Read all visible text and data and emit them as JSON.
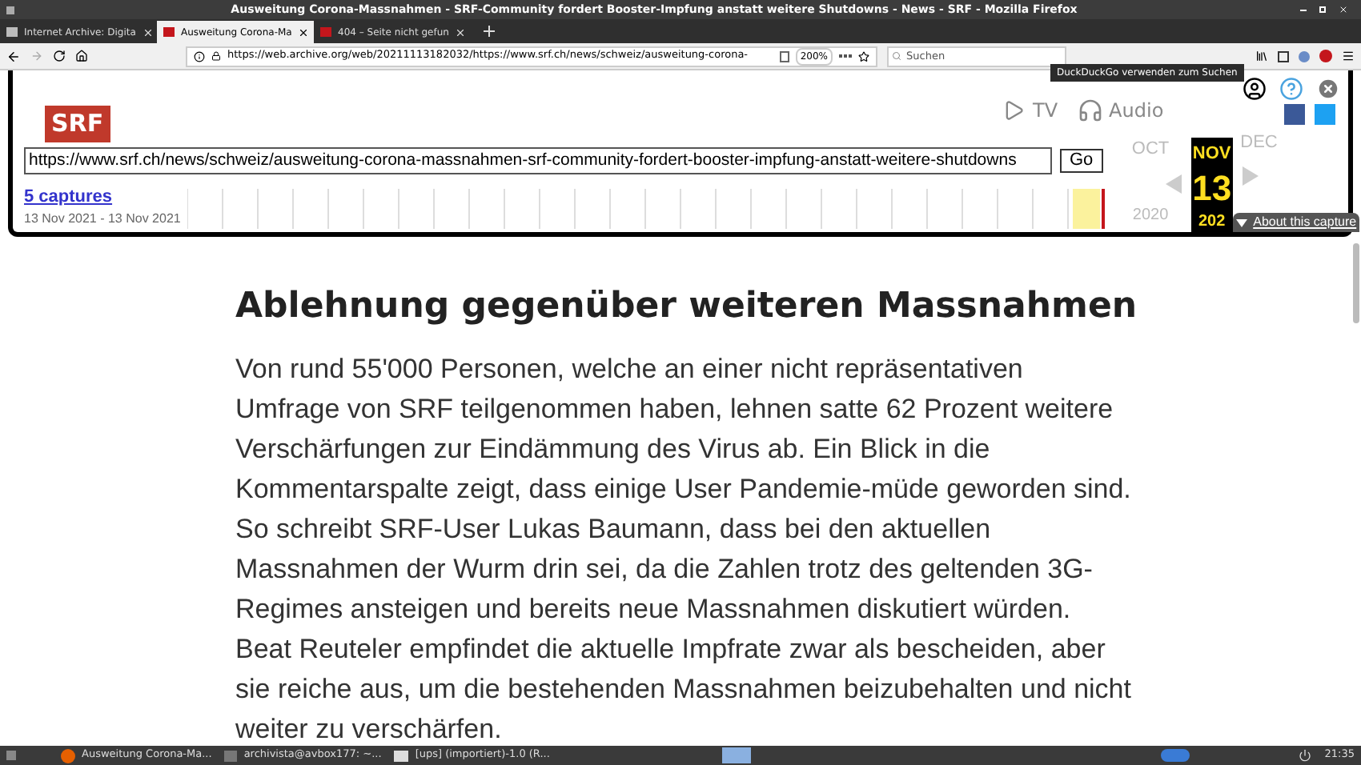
{
  "window": {
    "title": "Ausweitung Corona-Massnahmen - SRF-Community fordert Booster-Impfung anstatt weitere Shutdowns - News - SRF - Mozilla Firefox"
  },
  "tabs": [
    {
      "label": "Internet Archive: Digita",
      "selected": false
    },
    {
      "label": "Ausweitung Corona-Ma",
      "selected": true
    },
    {
      "label": "404 – Seite nicht gefun",
      "selected": false
    }
  ],
  "address_bar": {
    "url": "https://web.archive.org/web/20211113182032/https://www.srf.ch/news/schweiz/ausweitung-corona-",
    "zoom": "200%"
  },
  "search": {
    "placeholder": "Suchen"
  },
  "tooltip": "DuckDuckGo verwenden zum Suchen",
  "site_background": {
    "logo": "SRF",
    "nav": [
      "TV",
      "Audio"
    ]
  },
  "wayback": {
    "url": "https://www.srf.ch/news/schweiz/ausweitung-corona-massnahmen-srf-community-fordert-booster-impfung-anstatt-weitere-shutdowns",
    "go": "Go",
    "captures": "5 captures",
    "range": "13 Nov 2021 - 13 Nov 2021",
    "months": [
      {
        "label": "OCT",
        "selected": false
      },
      {
        "label": "NOV",
        "selected": true
      },
      {
        "label": "DEC",
        "selected": false
      }
    ],
    "day": "13",
    "years": [
      {
        "label": "2020",
        "selected": false
      },
      {
        "label": "202",
        "selected": true
      }
    ],
    "about": "About this capture"
  },
  "article": {
    "heading": "Ablehnung gegenüber weiteren Massnahmen",
    "paragraph": "Von rund 55'000 Personen, welche an einer nicht repräsentativen Umfrage von SRF teilgenommen haben, lehnen satte 62 Prozent weitere Verschärfungen zur Eindämmung des Virus ab. Ein Blick in die Kommentarspalte zeigt, dass einige User Pandemie-müde geworden sind. So schreibt SRF-User Lukas Baumann, dass bei den aktuellen Massnahmen der Wurm drin sei, da die Zahlen trotz des geltenden 3G-Regimes ansteigen und bereits neue Massnahmen diskutiert würden. Beat Reuteler empfindet die aktuelle Impfrate zwar als bescheiden, aber sie reiche aus, um die bestehenden Massnahmen beizubehalten und nicht weiter zu verschärfen."
  },
  "taskbar": {
    "items": [
      {
        "label": "Ausweitung Corona-Ma...",
        "kind": "browser"
      },
      {
        "label": "archivista@avbox177: ~...",
        "kind": "terminal"
      },
      {
        "label": "[ups] (importiert)-1.0 (R...",
        "kind": "folder"
      }
    ],
    "clock": "21:35"
  }
}
